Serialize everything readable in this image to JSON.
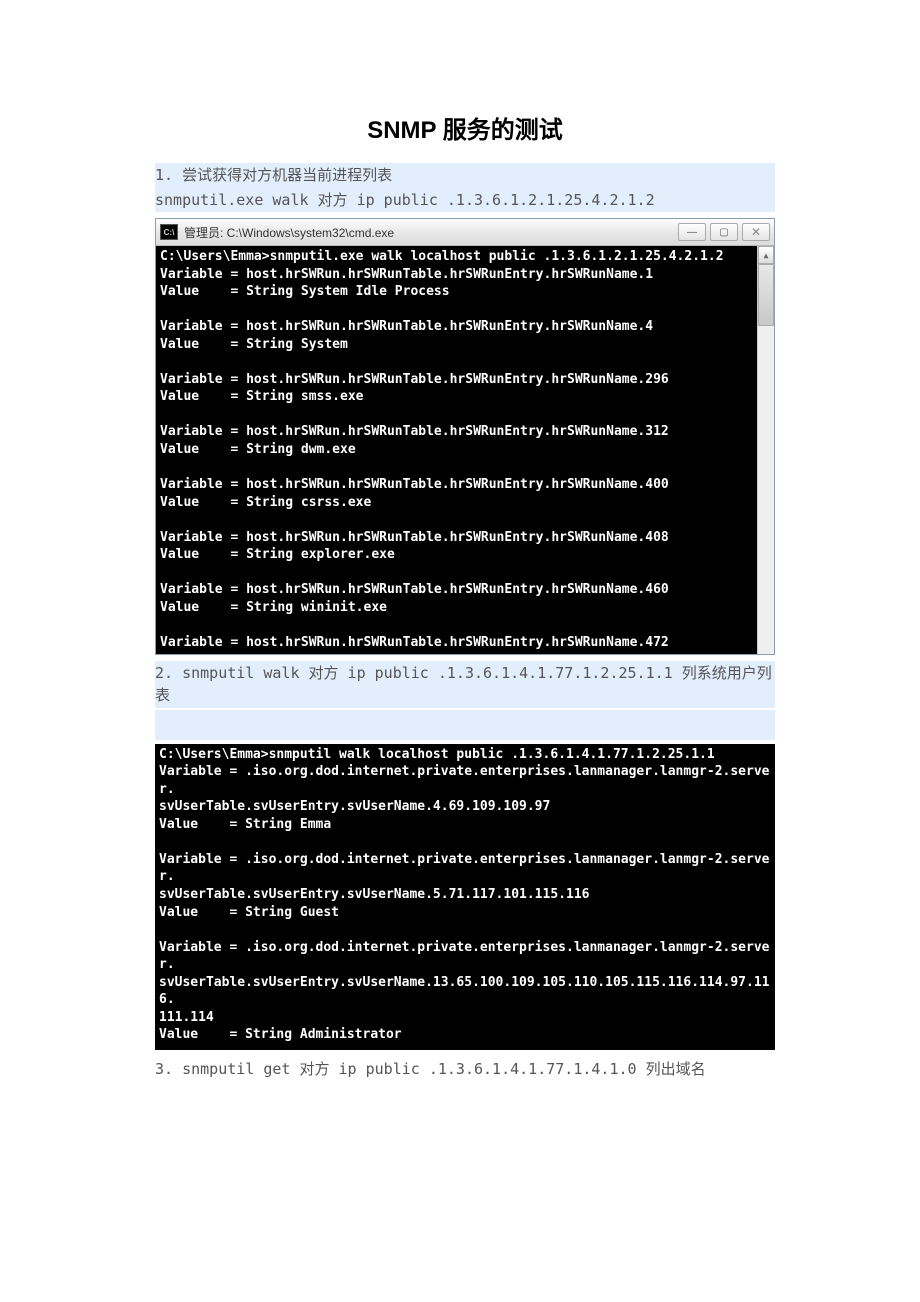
{
  "title": "SNMP 服务的测试",
  "section1": {
    "heading": "1. 尝试获得对方机器当前进程列表",
    "command": "snmputil.exe walk 对方 ip public .1.3.6.1.2.1.25.4.2.1.2"
  },
  "cmdWindow1": {
    "title": "管理员: C:\\Windows\\system32\\cmd.exe",
    "output": "C:\\Users\\Emma>snmputil.exe walk localhost public .1.3.6.1.2.1.25.4.2.1.2\nVariable = host.hrSWRun.hrSWRunTable.hrSWRunEntry.hrSWRunName.1\nValue    = String System Idle Process\n\nVariable = host.hrSWRun.hrSWRunTable.hrSWRunEntry.hrSWRunName.4\nValue    = String System\n\nVariable = host.hrSWRun.hrSWRunTable.hrSWRunEntry.hrSWRunName.296\nValue    = String smss.exe\n\nVariable = host.hrSWRun.hrSWRunTable.hrSWRunEntry.hrSWRunName.312\nValue    = String dwm.exe\n\nVariable = host.hrSWRun.hrSWRunTable.hrSWRunEntry.hrSWRunName.400\nValue    = String csrss.exe\n\nVariable = host.hrSWRun.hrSWRunTable.hrSWRunEntry.hrSWRunName.408\nValue    = String explorer.exe\n\nVariable = host.hrSWRun.hrSWRunTable.hrSWRunEntry.hrSWRunName.460\nValue    = String wininit.exe\n\nVariable = host.hrSWRun.hrSWRunTable.hrSWRunEntry.hrSWRunName.472"
  },
  "section2": {
    "text": "2. snmputil walk 对方 ip public .1.3.6.1.4.1.77.1.2.25.1.1 列系统用户列表"
  },
  "cmdBlock2": {
    "output": "C:\\Users\\Emma>snmputil walk localhost public .1.3.6.1.4.1.77.1.2.25.1.1\nVariable = .iso.org.dod.internet.private.enterprises.lanmanager.lanmgr-2.server.\nsvUserTable.svUserEntry.svUserName.4.69.109.109.97\nValue    = String Emma\n\nVariable = .iso.org.dod.internet.private.enterprises.lanmanager.lanmgr-2.server.\nsvUserTable.svUserEntry.svUserName.5.71.117.101.115.116\nValue    = String Guest\n\nVariable = .iso.org.dod.internet.private.enterprises.lanmanager.lanmgr-2.server.\nsvUserTable.svUserEntry.svUserName.13.65.100.109.105.110.105.115.116.114.97.116.\n111.114\nValue    = String Administrator"
  },
  "section3": {
    "text": "3. snmputil get 对方 ip public .1.3.6.1.4.1.77.1.4.1.0 列出域名"
  },
  "winButtons": {
    "min": "—",
    "max": "▢",
    "close": "✕"
  },
  "icons": {
    "cmd": "C:\\",
    "up": "▲",
    "down": "▼"
  }
}
